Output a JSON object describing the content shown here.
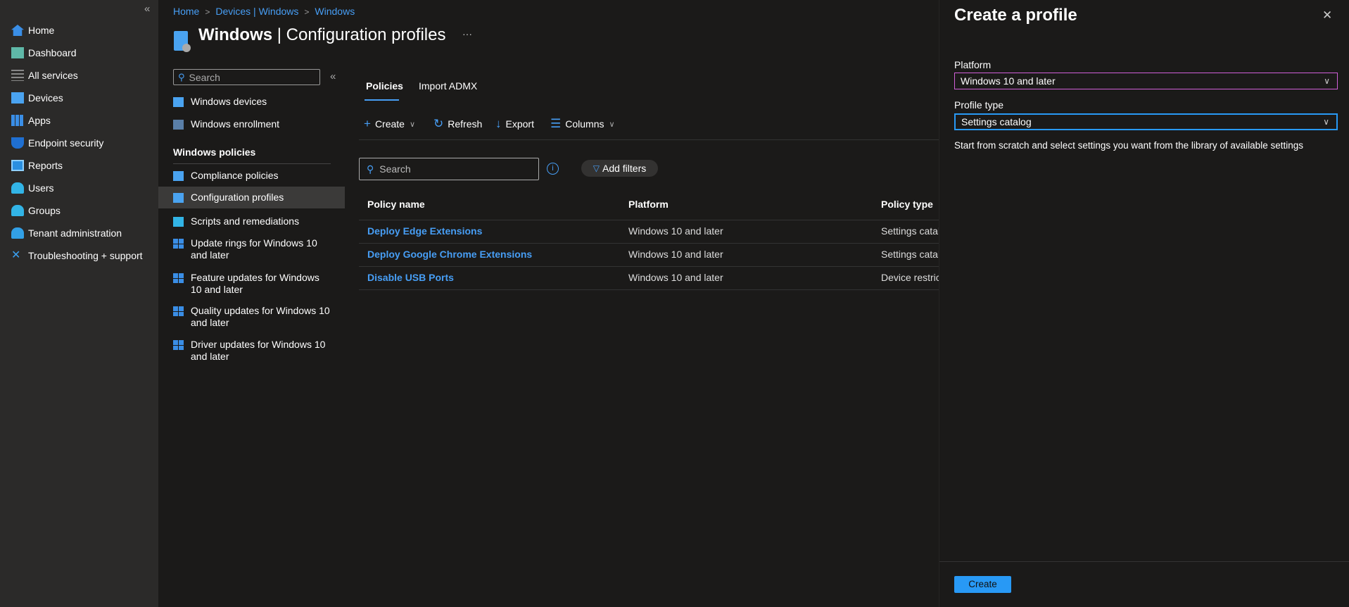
{
  "leftnav": {
    "collapse": "«",
    "items": [
      {
        "label": "Home",
        "icon": "home-icon"
      },
      {
        "label": "Dashboard",
        "icon": "dashboard-icon"
      },
      {
        "label": "All services",
        "icon": "list-icon"
      },
      {
        "label": "Devices",
        "icon": "devices-icon"
      },
      {
        "label": "Apps",
        "icon": "apps-icon"
      },
      {
        "label": "Endpoint security",
        "icon": "shield-icon"
      },
      {
        "label": "Reports",
        "icon": "reports-icon"
      },
      {
        "label": "Users",
        "icon": "user-icon"
      },
      {
        "label": "Groups",
        "icon": "group-icon"
      },
      {
        "label": "Tenant administration",
        "icon": "tenant-admin-icon"
      },
      {
        "label": "Troubleshooting + support",
        "icon": "wrench-icon"
      }
    ]
  },
  "breadcrumb": [
    "Home",
    "Devices | Windows",
    "Windows"
  ],
  "header": {
    "title_bold": "Windows",
    "title_rest": " | Configuration profiles",
    "more": "···"
  },
  "menu": {
    "search_placeholder": "Search",
    "collapse": "«",
    "top_items": [
      "Windows devices",
      "Windows enrollment"
    ],
    "section": "Windows policies",
    "items": [
      "Compliance policies",
      "Configuration profiles",
      "Scripts and remediations",
      "Update rings for Windows 10 and later",
      "Feature updates for Windows 10 and later",
      "Quality updates for Windows 10 and later",
      "Driver updates for Windows 10 and later"
    ],
    "selected": "Configuration profiles"
  },
  "tabs": [
    "Policies",
    "Import ADMX"
  ],
  "toolbar": {
    "create": "Create",
    "refresh": "Refresh",
    "export": "Export",
    "columns": "Columns"
  },
  "filter": {
    "search_placeholder": "Search",
    "add_filters": "Add filters"
  },
  "table": {
    "headers": [
      "Policy name",
      "Platform",
      "Policy type"
    ],
    "rows": [
      [
        "Deploy Edge Extensions",
        "Windows 10 and later",
        "Settings catalog"
      ],
      [
        "Deploy Google Chrome Extensions",
        "Windows 10 and later",
        "Settings catalog"
      ],
      [
        "Disable USB Ports",
        "Windows 10 and later",
        "Device restrictions"
      ]
    ]
  },
  "panel": {
    "title": "Create a profile",
    "close": "✕",
    "platform_label": "Platform",
    "platform_value": "Windows 10 and later",
    "profile_type_label": "Profile type",
    "profile_type_value": "Settings catalog",
    "description": "Start from scratch and select settings you want from the library of available settings",
    "create_button": "Create"
  },
  "colors": {
    "accent": "#479ef5",
    "button": "#2899f5",
    "platform_border": "#d160d8"
  }
}
